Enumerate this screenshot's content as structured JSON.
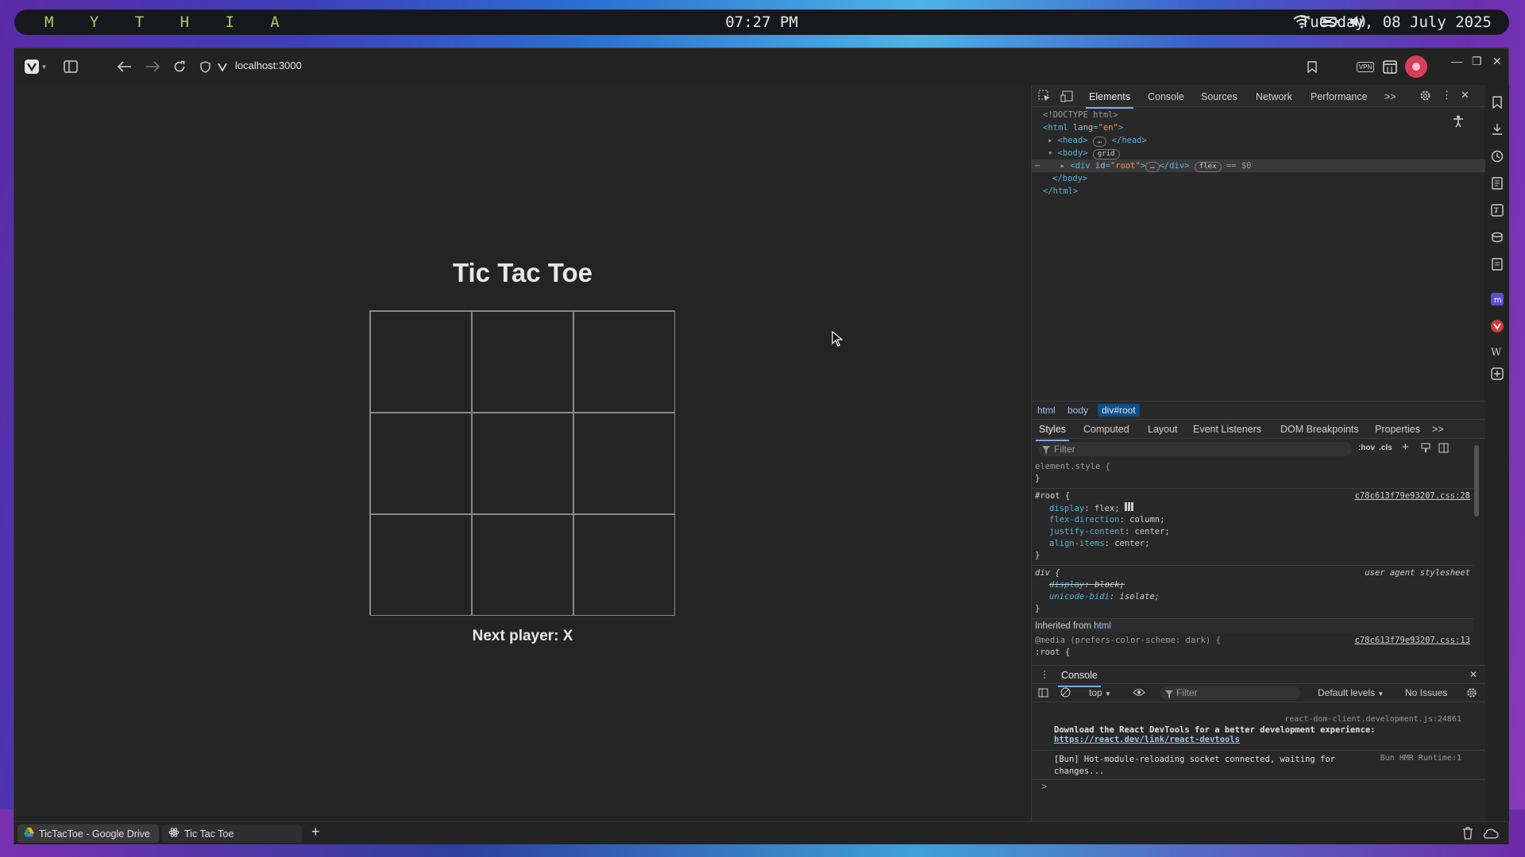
{
  "system_bar": {
    "brand": "M Y T H I A",
    "clock": "07:27 PM",
    "date": "Tuesday, 08 July 2025"
  },
  "browser": {
    "url": "localhost:3000",
    "vpn_label": "VPN",
    "tabs": [
      {
        "label": "TicTacToe - Google Drive",
        "icon": "google-drive-icon"
      },
      {
        "label": "Tic Tac Toe",
        "icon": "react-icon",
        "active": true
      }
    ]
  },
  "app": {
    "title": "Tic Tac Toe",
    "cells": [
      "",
      "",
      "",
      "",
      "",
      "",
      "",
      "",
      ""
    ],
    "status": "Next player: X"
  },
  "devtools": {
    "tabs": [
      "Elements",
      "Console",
      "Sources",
      "Network",
      "Performance"
    ],
    "more_tabs": ">>",
    "dom": {
      "doctype": "<!DOCTYPE html>",
      "html_open": "<html",
      "lang_attr": "lang",
      "lang_val": "\"en\"",
      "head": "<head>",
      "head_close": "</head>",
      "body": "<body>",
      "body_badge": "grid",
      "div_open": "<div",
      "id_attr": "id",
      "id_val": "\"root\"",
      "div_close": "</div>",
      "div_badge": "flex",
      "eq_ref": "== $0",
      "body_close": "</body>",
      "html_close": "</html>"
    },
    "breadcrumbs": [
      "html",
      "body",
      "div#root"
    ],
    "style_tabs": [
      "Styles",
      "Computed",
      "Layout",
      "Event Listeners",
      "DOM Breakpoints",
      "Properties"
    ],
    "filter_placeholder": "Filter",
    "hov": ":hov",
    "cls": ".cls",
    "styles": {
      "element_style": "element.style {",
      "close": "}",
      "root_selector": "#root {",
      "root_source": "c78c613f79e93207.css:28",
      "root_props": [
        {
          "name": "display",
          "value": "flex;"
        },
        {
          "name": "flex-direction",
          "value": "column;"
        },
        {
          "name": "justify-content",
          "value": "center;"
        },
        {
          "name": "align-items",
          "value": "center;"
        }
      ],
      "div_selector": "div {",
      "div_source": "user agent stylesheet",
      "div_props": [
        {
          "name": "display",
          "value": "block;",
          "struck": true
        },
        {
          "name": "unicode-bidi",
          "value": "isolate;"
        }
      ],
      "inherited_label": "Inherited from",
      "inherited_tag": "html",
      "media_rule": "@media (prefers-color-scheme: dark) {",
      "media_source": "c78c613f79e93207.css:13",
      "media_selector": ":root {"
    },
    "console": {
      "title": "Console",
      "context": "top",
      "filter_placeholder": "Filter",
      "levels": "Default levels",
      "issues": "No Issues",
      "messages": [
        {
          "source": "react-dom-client.development.js:24861",
          "text": "Download the React DevTools for a better development experience:",
          "link": "https://react.dev/link/react-devtools"
        },
        {
          "source": "Bun HMR Runtime:1",
          "text_line1": "[Bun] Hot-module-reloading socket connected, waiting for",
          "text_line2": "changes..."
        }
      ],
      "prompt": ">"
    }
  },
  "colors": {
    "page_bg": "#242424",
    "board_line": "#8a8a8a",
    "accent": "#7cacf8",
    "brand_text": "#b8c66a"
  }
}
